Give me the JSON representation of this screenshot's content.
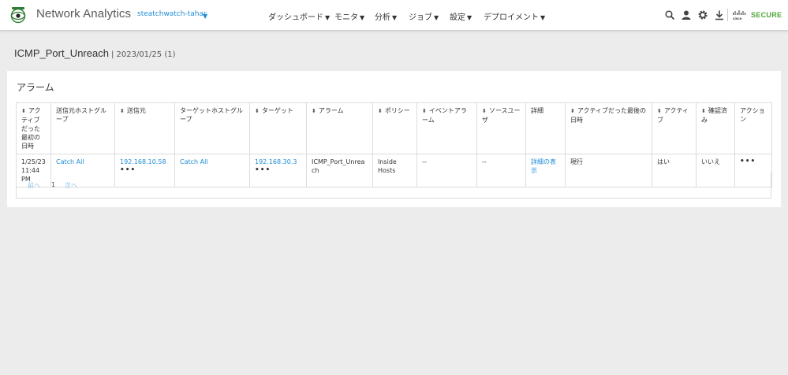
{
  "header": {
    "app_title": "Network Analytics",
    "tenant": "steatchwatch-tahar",
    "nav": [
      {
        "label": "ダッシュボード"
      },
      {
        "label": "モニタ"
      },
      {
        "label": "分析"
      },
      {
        "label": "ジョブ"
      },
      {
        "label": "設定"
      },
      {
        "label": "デプロイメント"
      }
    ],
    "brand": "SECURE",
    "brand_color": "#4fa63b",
    "accent_color": "#1f8dd6",
    "icons": [
      "search-icon",
      "user-icon",
      "gear-icon",
      "download-icon",
      "cisco-logo-icon"
    ]
  },
  "page": {
    "title": "ICMP_Port_Unreach",
    "subtitle": "| 2023/01/25 (1)"
  },
  "alarms": {
    "title": "アラーム",
    "columns": [
      "アクティブだった最初の日時",
      "送信元ホストグループ",
      "送信元",
      "ターゲットホストグループ",
      "ターゲット",
      "アラーム",
      "ポリシー",
      "イベントアラーム",
      "ソースユーザ",
      "詳細",
      "アクティブだった最後の日時",
      "アクティブ",
      "確認済み",
      "アクション"
    ],
    "rows": [
      {
        "first_active": "1/25/23 11:44 PM",
        "source_group": "Catch All",
        "source": "192.168.10.58",
        "target_group": "Catch All",
        "target": "192.168.30.3",
        "alarm": "ICMP_Port_Unreach",
        "policy": "Inside Hosts",
        "event_alarm": "--",
        "source_user": "--",
        "details": "詳細の表示",
        "last_active": "現行",
        "active": "はい",
        "acknowledged": "いいえ",
        "actions": "•••",
        "source_more": "•••",
        "target_more": "•••"
      }
    ],
    "pager": {
      "prev": "前へ",
      "page": "1",
      "next": "次へ"
    }
  }
}
